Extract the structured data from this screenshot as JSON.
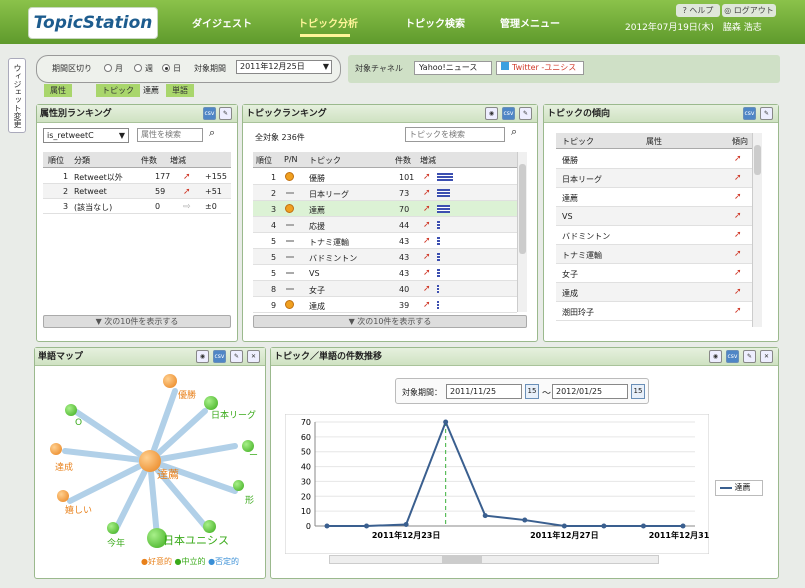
{
  "header": {
    "logo": "TopicStation",
    "nav": [
      "ダイジェスト",
      "トピック分析",
      "トピック検索",
      "管理メニュー"
    ],
    "help": "? ヘルプ",
    "logout": "◎ ログアウト",
    "date": "2012年07月19日(木)",
    "user": "脇森 浩志"
  },
  "side_tab": "ウィジェット変更",
  "filter": {
    "label": "期間区切り",
    "options": [
      "月",
      "週",
      "日"
    ],
    "selected": "日",
    "period_label": "対象期間",
    "period_value": "2011年12月25日"
  },
  "channel": {
    "label": "対象チャネル",
    "chips": [
      "Yahoo!ニュース",
      "Twitter -ユニシス"
    ]
  },
  "breadcrumb": [
    "属性",
    "トピック",
    "達薦",
    "単語"
  ],
  "attr_ranking": {
    "title": "属性別ランキング",
    "select": "is_retweetC",
    "search_placeholder": "属性を検索",
    "headers": [
      "順位",
      "分類",
      "件数",
      "増減"
    ],
    "rows": [
      {
        "rank": "1",
        "name": "Retweet以外",
        "count": "177",
        "diff": "+155"
      },
      {
        "rank": "2",
        "name": "Retweet",
        "count": "59",
        "diff": "+51"
      },
      {
        "rank": "3",
        "name": "(該当なし)",
        "count": "0",
        "diff": "±0"
      }
    ],
    "next": "▼ 次の10件を表示する"
  },
  "topic_ranking": {
    "title": "トピックランキング",
    "total": "全対象 236件",
    "search_placeholder": "トピックを検索",
    "headers": [
      "順位",
      "P/N",
      "トピック",
      "件数",
      "増減"
    ],
    "rows": [
      {
        "rank": "1",
        "pn": "pos",
        "topic": "優勝",
        "count": "101",
        "bar": 0.9
      },
      {
        "rank": "2",
        "pn": "neu",
        "topic": "日本リーグ",
        "count": "73",
        "bar": 0.72
      },
      {
        "rank": "3",
        "pn": "pos",
        "topic": "達薦",
        "count": "70",
        "bar": 0.7
      },
      {
        "rank": "4",
        "pn": "neu",
        "topic": "応援",
        "count": "44",
        "bar": 0.15
      },
      {
        "rank": "5",
        "pn": "neu",
        "topic": "トナミ運輸",
        "count": "43",
        "bar": 0.15
      },
      {
        "rank": "5",
        "pn": "neu",
        "topic": "バドミントン",
        "count": "43",
        "bar": 0.15
      },
      {
        "rank": "5",
        "pn": "neu",
        "topic": "VS",
        "count": "43",
        "bar": 0.15
      },
      {
        "rank": "8",
        "pn": "neu",
        "topic": "女子",
        "count": "40",
        "bar": 0.12
      },
      {
        "rank": "9",
        "pn": "pos",
        "topic": "達成",
        "count": "39",
        "bar": 0.12
      }
    ],
    "next": "▼ 次の10件を表示する"
  },
  "topic_trend": {
    "title": "トピックの傾向",
    "headers": [
      "トピック",
      "属性",
      "傾向"
    ],
    "rows": [
      "優勝",
      "日本リーグ",
      "達薦",
      "VS",
      "バドミントン",
      "トナミ運輸",
      "女子",
      "達成",
      "潮田玲子"
    ]
  },
  "word_map": {
    "title": "単語マップ",
    "center": "達薦",
    "words": [
      "優勝",
      "日本リーグ",
      "O",
      "ー",
      "達成",
      "形",
      "嬉しい",
      "今年",
      "日本ユニシス"
    ],
    "legend": [
      "●好意的",
      "●中立的",
      "●否定的"
    ]
  },
  "trend_chart": {
    "title": "トピック／単語の件数推移",
    "period_label": "対象期間：",
    "from": "2011/11/25",
    "to": "2012/01/25",
    "legend": "達薦",
    "cal": "15"
  },
  "chart_data": {
    "type": "line",
    "title": "",
    "series": [
      {
        "name": "達薦",
        "values": [
          0,
          0,
          1,
          70,
          7,
          4,
          0,
          0,
          0,
          0
        ]
      }
    ],
    "x": [
      "2011-12-21",
      "2011-12-22",
      "2011-12-23",
      "2011-12-24",
      "2011-12-25",
      "2011-12-26",
      "2011-12-27",
      "2011-12-28",
      "2011-12-29",
      "2011-12-30"
    ],
    "x_tick_labels": [
      "2011年12月23日",
      "2011年12月27日",
      "2011年12月31日"
    ],
    "ylim": [
      0,
      70
    ],
    "yticks": [
      0,
      10,
      20,
      30,
      40,
      50,
      60,
      70
    ],
    "color": "#3a5f8f"
  },
  "colors": {
    "header": "#6aa834",
    "accent": "#a9d66c",
    "line": "#3a5f8f",
    "positive": "#f0a020",
    "neutral": "#5dc43a",
    "negative": "#3a8fd6"
  }
}
